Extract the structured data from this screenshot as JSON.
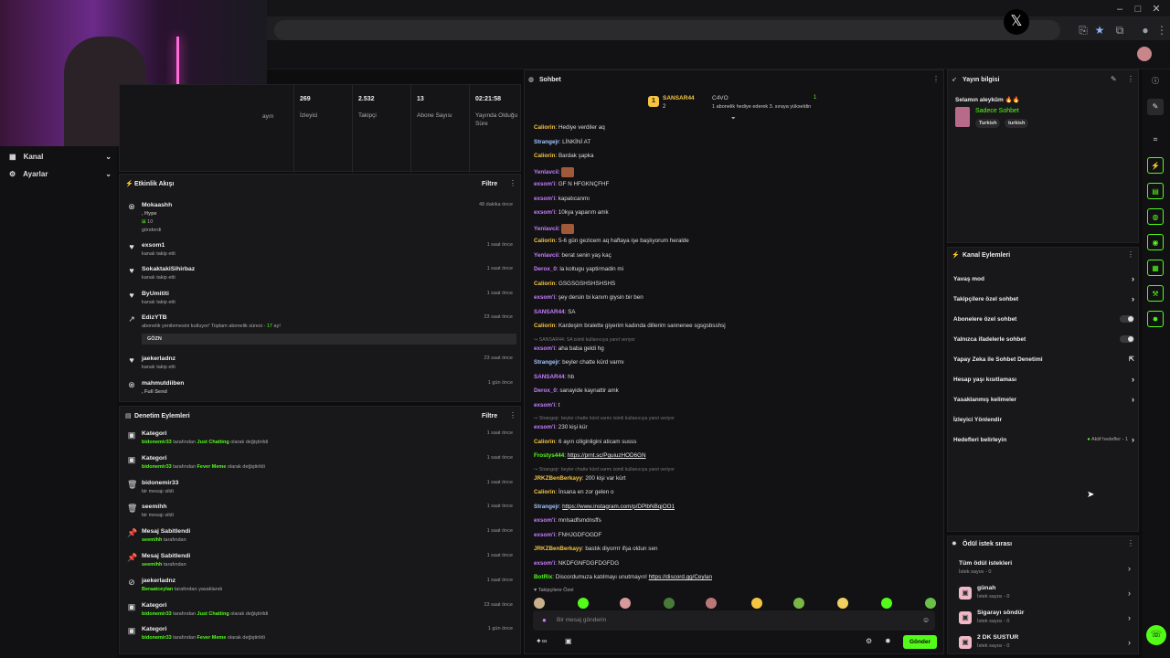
{
  "stats": [
    {
      "value": "",
      "label": "ayın"
    },
    {
      "value": "269",
      "label": "İzleyici"
    },
    {
      "value": "2.532",
      "label": "Takipçi"
    },
    {
      "value": "13",
      "label": "Abone Sayısı"
    },
    {
      "value": "02:21:58",
      "label": "Yayında Olduğu Süre"
    }
  ],
  "sidebar": {
    "items": [
      {
        "label": "Kanal"
      },
      {
        "label": "Ayarlar"
      }
    ]
  },
  "activity": {
    "title": "Etkinlik Akışı",
    "filter": "Filtre",
    "items": [
      {
        "name": "Mokaashh",
        "sub1": ", Hype",
        "sub2": "10",
        "sub3": "gönderdi",
        "time": "48 dakika önce"
      },
      {
        "name": "exsom1",
        "sub": "kanalı takip etti",
        "time": "1 saat önce"
      },
      {
        "name": "SokaktakiSihirbaz",
        "sub": "kanalı takip etti",
        "time": "1 saat önce"
      },
      {
        "name": "ByUmititi",
        "sub": "kanalı takip etti",
        "time": "1 saat önce"
      },
      {
        "name": "EdizYTB",
        "sub": "abonelik yenilemesini kutluyor! Toplam abonelik süresi -",
        "months": "17",
        "months_suffix": "ay!",
        "msg": "GÖZN",
        "time": "23 saat önce"
      },
      {
        "name": "jaekerladnz",
        "sub": "kanalı takip etti",
        "time": "23 saat önce"
      },
      {
        "name": "mahmutdiiben",
        "sub": ", Full Send",
        "time": "1 gün önce"
      }
    ]
  },
  "moderation": {
    "title": "Denetim Eylemleri",
    "filter": "Filtre",
    "items": [
      {
        "title": "Kategori",
        "actor": "bidonemir33",
        "mid": "tarafından",
        "target": "Just Chatting",
        "tail": "olarak değiştirildi",
        "time": "1 saat önce"
      },
      {
        "title": "Kategori",
        "actor": "bidonemir33",
        "mid": "tarafından",
        "target": "Fever Meme",
        "tail": "olarak değiştirildi",
        "time": "1 saat önce"
      },
      {
        "title": "bidonemir33",
        "actor": "",
        "mid": "bir mesajı sildi",
        "target": "",
        "tail": "",
        "time": "1 saat önce"
      },
      {
        "title": "seemihh",
        "actor": "",
        "mid": "bir mesajı sildi",
        "target": "",
        "tail": "",
        "time": "1 saat önce"
      },
      {
        "title": "Mesaj Sabitlendi",
        "actor": "seemihh",
        "mid": "tarafından",
        "target": "",
        "tail": "",
        "time": "1 saat önce"
      },
      {
        "title": "Mesaj Sabitlendi",
        "actor": "seemihh",
        "mid": "tarafından",
        "target": "",
        "tail": "",
        "time": "1 saat önce"
      },
      {
        "title": "jaekerladnz",
        "actor": "Beraatceylan",
        "mid": "tarafından yasaklandı",
        "target": "",
        "tail": "",
        "time": "1 saat önce"
      },
      {
        "title": "Kategori",
        "actor": "bidonemir33",
        "mid": "tarafından",
        "target": "Just Chatting",
        "tail": "olarak değiştirildi",
        "time": "23 saat önce"
      },
      {
        "title": "Kategori",
        "actor": "bidonemir33",
        "mid": "tarafından",
        "target": "Fever Meme",
        "tail": "olarak değiştirildi",
        "time": "1 gün önce"
      }
    ]
  },
  "chat": {
    "title": "Sohbet",
    "gifter_name": "SANSAR44",
    "gifter_count": "2",
    "gifter2": "C4VO",
    "gifter2_count": "1",
    "gift_note": "1 abonelik hediye ederek 3. sıraya yükseldin",
    "messages": [
      {
        "user": "Caliorin",
        "color": "#f5c542",
        "text": "Hediye verdiler aq"
      },
      {
        "user": "Strangejr",
        "color": "#9fc5ff",
        "text": "LİNKİNİ AT"
      },
      {
        "user": "Caliorin",
        "color": "#f5c542",
        "text": "Bardak şapka"
      },
      {
        "user": "Yenlavcii",
        "color": "#c77dff",
        "text": ""
      },
      {
        "user": "exsom'i",
        "color": "#c77dff",
        "text": "GF N HFGKNÇFHF"
      },
      {
        "user": "exsom'i",
        "color": "#c77dff",
        "text": "kapatıcanmı"
      },
      {
        "user": "exsom'i",
        "color": "#c77dff",
        "text": "10kya yaparım amk"
      },
      {
        "user": "Yenlavcii",
        "color": "#c77dff",
        "text": ""
      },
      {
        "user": "Caliorin",
        "color": "#f5c542",
        "text": "5-6 gün gezicem aq haftaya işe başlıyorum heralde"
      },
      {
        "user": "Yenlavcii",
        "color": "#c77dff",
        "text": "berat senin yaş kaç"
      },
      {
        "user": "Derox_0",
        "color": "#c77dff",
        "text": "la koltugu yaptirmadin mi"
      },
      {
        "user": "Caliorin",
        "color": "#f5c542",
        "text": "GSGSGSHSHSHSHS"
      },
      {
        "user": "exsom'i",
        "color": "#c77dff",
        "text": "şey dersin bi kanım giysin bir ben"
      },
      {
        "user": "SANSAR44",
        "color": "#c77dff",
        "text": "SA"
      },
      {
        "user": "Caliorin",
        "color": "#f5c542",
        "text": "Kardeşim bralette giyerim kadında dillerim sannenee sgsgsbsshsj"
      },
      {
        "user": "exsom'i",
        "color": "#c77dff",
        "text": "aha baba geldi hg",
        "reply": "SANSAR44: SA isimli kullanıcıya yanıt veriyor"
      },
      {
        "user": "Strangejr",
        "color": "#9fc5ff",
        "text": "beyler chatte kürd varmı"
      },
      {
        "user": "SANSAR44",
        "color": "#c77dff",
        "text": "hb"
      },
      {
        "user": "Derox_0",
        "color": "#c77dff",
        "text": "sanayide kaynattir amk"
      },
      {
        "user": "exsom'i",
        "color": "#c77dff",
        "text": "t"
      },
      {
        "user": "exsom'i",
        "color": "#c77dff",
        "text": "230 kişi kür",
        "reply": "Strangejr: beyler chatte kürd varmı isimli kullanıcıya yanıt veriyor"
      },
      {
        "user": "Caliorin",
        "color": "#f5c542",
        "text": "6 ayın ciliginligini aticam susss"
      },
      {
        "user": "Frostys444",
        "color": "#53fc18",
        "text": "",
        "link": "https://prnt.sc/PguiuzHOD6GN"
      },
      {
        "user": "JRKZBenBerkayy",
        "color": "#f5c542",
        "text": "200 kişi var kürt",
        "reply": "Strangejr: beyler chatte kürd varmı isimli kullanıcıya yanıt veriyor"
      },
      {
        "user": "Caliorin",
        "color": "#f5c542",
        "text": "İnsana en zor gelen o"
      },
      {
        "user": "Strangejr",
        "color": "#9fc5ff",
        "text": "",
        "link": "https://www.instagram.com/p/DPlbNBqjOO1"
      },
      {
        "user": "exsom'i",
        "color": "#c77dff",
        "text": "mnlsadfsmdnsffs"
      },
      {
        "user": "exsom'i",
        "color": "#c77dff",
        "text": "FNHJGDFOGDF"
      },
      {
        "user": "JRKZBenBerkayy",
        "color": "#f5c542",
        "text": "bastık diyorrrr ifşa oldun sen"
      },
      {
        "user": "exsom'i",
        "color": "#c77dff",
        "text": "NKDFGNFDGFDGFDG"
      },
      {
        "user": "BotRix",
        "color": "#53fc18",
        "text": "Discordumuza katılmayı unutmayın!",
        "link": "https://discord.gg/Ceylan"
      }
    ],
    "follower_only": "Takipçilere Özel",
    "input_placeholder": "Bir mesaj gönderin",
    "send_label": "Gönder",
    "infinite": "∞"
  },
  "stream_info": {
    "title": "Yayın bilgisi",
    "greeting": "Selamın aleyküm 🔥🔥",
    "category": "Sadece Sohbet",
    "tags": [
      "Turkish",
      "turkish"
    ]
  },
  "channel_actions": {
    "title": "Kanal Eylemleri",
    "items": [
      {
        "label": "Yavaş mod",
        "kind": "chevron"
      },
      {
        "label": "Takipçilere özel sohbet",
        "kind": "chevron"
      },
      {
        "label": "Abonelere özel sohbet",
        "kind": "toggle"
      },
      {
        "label": "Yalnızca ifadelerle sohbet",
        "kind": "toggle"
      },
      {
        "label": "Yapay Zeka ile Sohbet Denetimi",
        "kind": "external"
      },
      {
        "label": "Hesap yaşı kısıtlaması",
        "kind": "chevron"
      },
      {
        "label": "Yasaklanmış kelimeler",
        "kind": "chevron"
      },
      {
        "label": "İzleyici Yönlendir",
        "kind": "none"
      },
      {
        "label": "Hedefleri belirleyin",
        "kind": "chevron",
        "extra": "Aktif hedefler - 1"
      }
    ]
  },
  "rewards": {
    "title": "Ödül istek sırası",
    "all": {
      "title": "Tüm ödül istekleri",
      "sub": "İstek sayısı - 0"
    },
    "items": [
      {
        "title": "günah",
        "sub": "İstek sayısı - 0"
      },
      {
        "title": "Sigarayı söndür",
        "sub": "İstek sayısı - 0"
      },
      {
        "title": "2 DK SUSTUR",
        "sub": "İstek sayısı - 0"
      }
    ]
  },
  "colors": {
    "accent": "#53fc18",
    "panel": "#18181a",
    "background": "#0d0d0e"
  }
}
